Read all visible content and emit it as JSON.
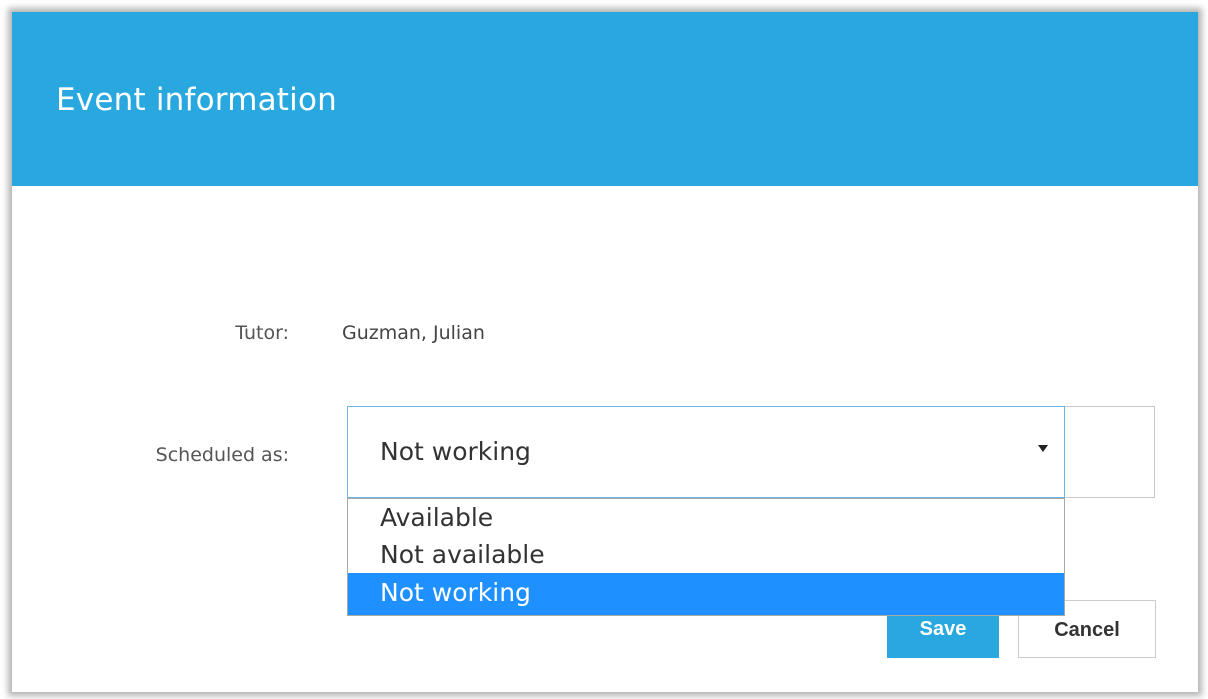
{
  "dialog": {
    "title": "Event information"
  },
  "form": {
    "tutor_label": "Tutor:",
    "tutor_value": "Guzman, Julian",
    "scheduled_label": "Scheduled as:",
    "scheduled_value": "Not working",
    "options": [
      "Available",
      "Not available",
      "Not working"
    ],
    "selected_index": 2
  },
  "buttons": {
    "save_label": "Save",
    "cancel_label": "Cancel"
  },
  "colors": {
    "header_bg": "#29a8e0",
    "selected_option_bg": "#1e90ff",
    "save_bg": "#29a8e0"
  },
  "icons": {
    "select_caret": "caret-down-icon"
  }
}
